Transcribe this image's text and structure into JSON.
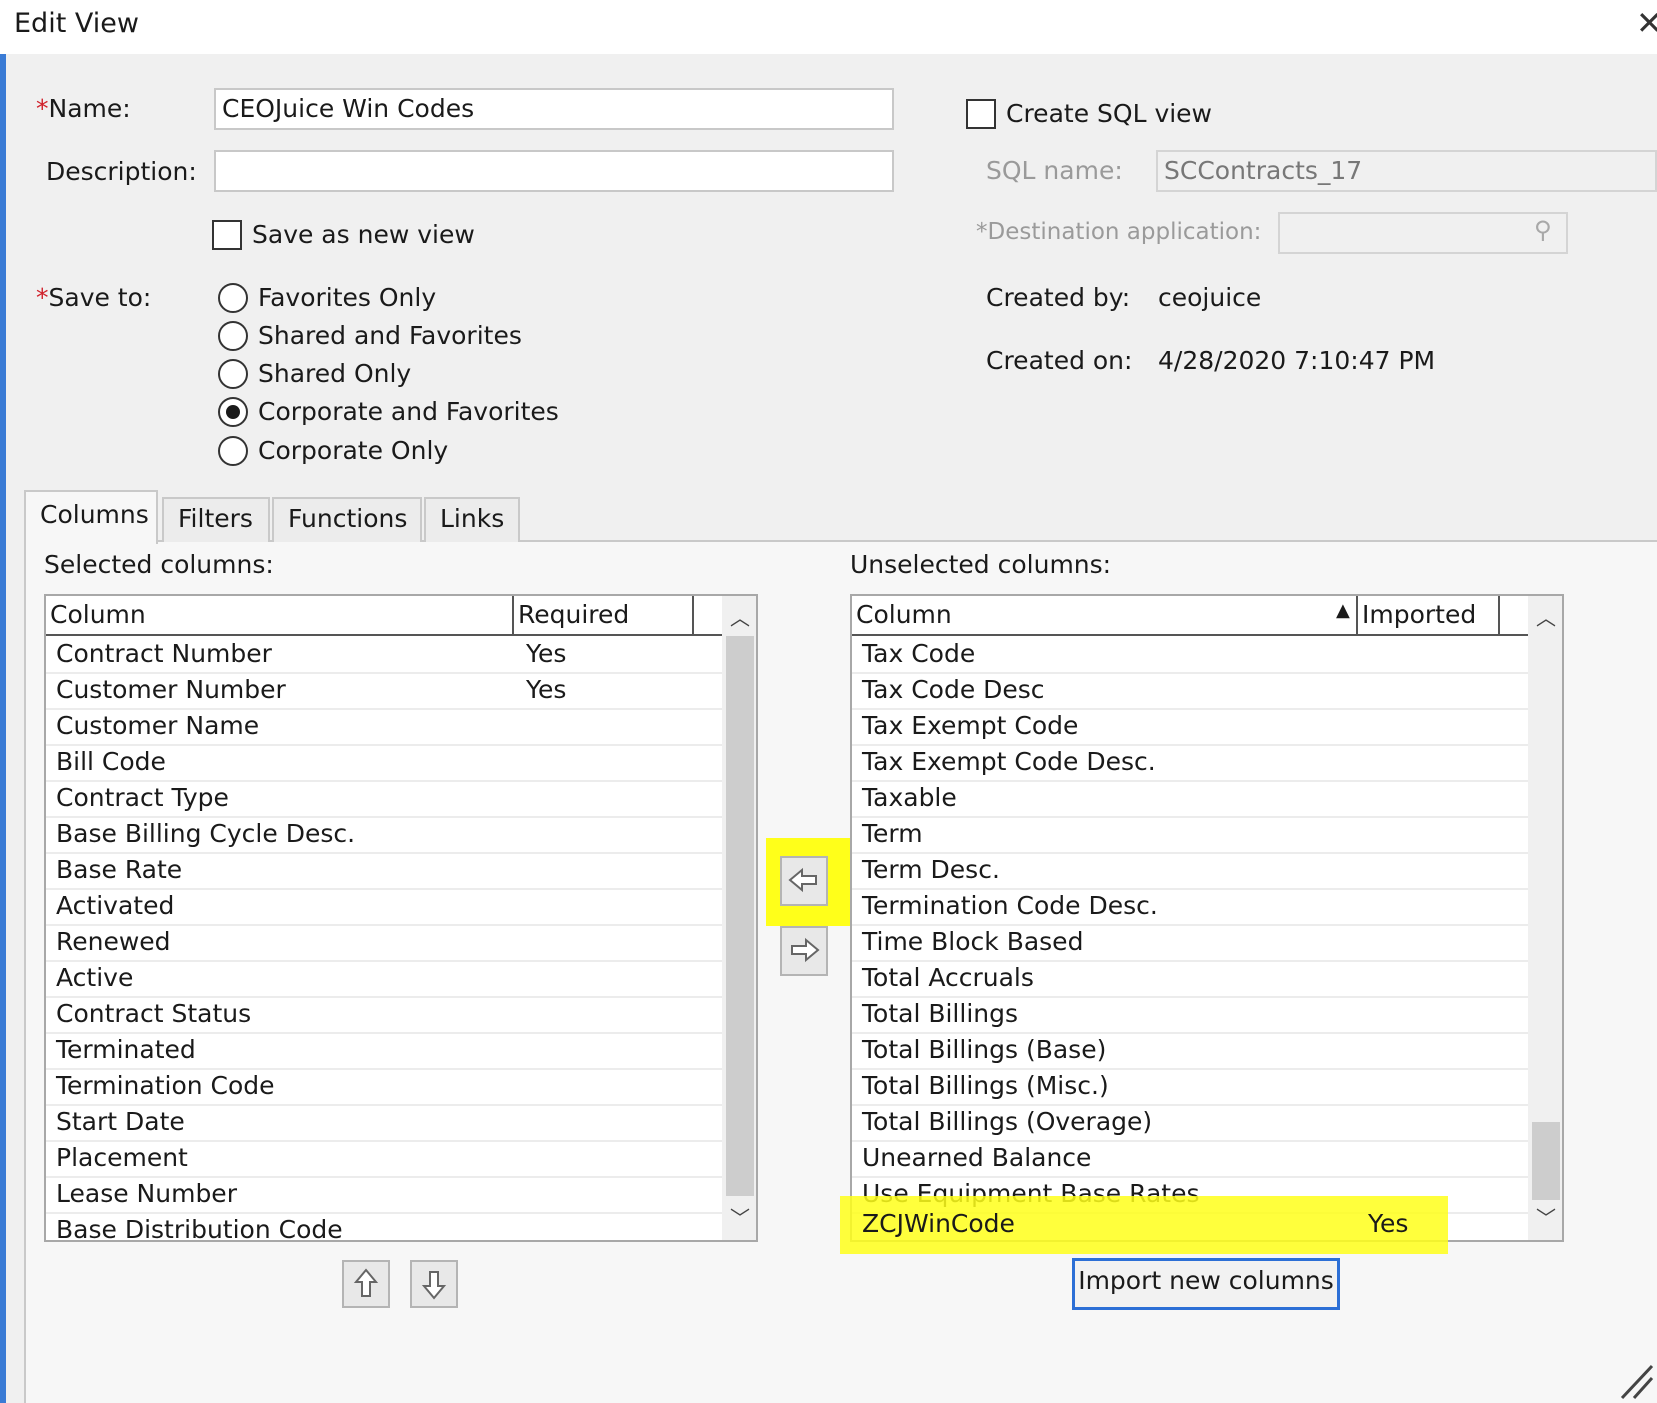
{
  "window": {
    "title": "Edit View"
  },
  "form": {
    "name_label": "Name:",
    "name_value": "CEOJuice Win Codes",
    "description_label": "Description:",
    "description_value": "",
    "save_as_new_label": "Save as new view",
    "save_to_label": "Save to:",
    "save_to_options": [
      "Favorites Only",
      "Shared and Favorites",
      "Shared Only",
      "Corporate and Favorites",
      "Corporate Only"
    ],
    "save_to_selected": "Corporate and Favorites"
  },
  "sql": {
    "create_sql_label": "Create SQL view",
    "sql_name_label": "SQL name:",
    "sql_name_value": "SCContracts_17",
    "destination_label": "*Destination application:",
    "destination_value": "",
    "created_by_label": "Created by:",
    "created_by_value": "ceojuice",
    "created_on_label": "Created on:",
    "created_on_value": "4/28/2020 7:10:47 PM"
  },
  "tabs": [
    "Columns",
    "Filters",
    "Functions",
    "Links"
  ],
  "active_tab": "Columns",
  "selected": {
    "label": "Selected columns:",
    "headers": [
      "Column",
      "Required"
    ],
    "rows": [
      [
        "Contract Number",
        "Yes"
      ],
      [
        "Customer Number",
        "Yes"
      ],
      [
        "Customer Name",
        ""
      ],
      [
        "Bill Code",
        ""
      ],
      [
        "Contract Type",
        ""
      ],
      [
        "Base Billing Cycle Desc.",
        ""
      ],
      [
        "Base Rate",
        ""
      ],
      [
        "Activated",
        ""
      ],
      [
        "Renewed",
        ""
      ],
      [
        "Active",
        ""
      ],
      [
        "Contract Status",
        ""
      ],
      [
        "Terminated",
        ""
      ],
      [
        "Termination Code",
        ""
      ],
      [
        "Start Date",
        ""
      ],
      [
        "Placement",
        ""
      ],
      [
        "Lease Number",
        ""
      ],
      [
        "Base Distribution Code",
        ""
      ]
    ]
  },
  "unselected": {
    "label": "Unselected columns:",
    "headers": [
      "Column",
      "Imported"
    ],
    "rows": [
      [
        "Tax Code",
        ""
      ],
      [
        "Tax Code Desc",
        ""
      ],
      [
        "Tax Exempt Code",
        ""
      ],
      [
        "Tax Exempt Code Desc.",
        ""
      ],
      [
        "Taxable",
        ""
      ],
      [
        "Term",
        ""
      ],
      [
        "Term Desc.",
        ""
      ],
      [
        "Termination Code Desc.",
        ""
      ],
      [
        "Time Block Based",
        ""
      ],
      [
        "Total Accruals",
        ""
      ],
      [
        "Total Billings",
        ""
      ],
      [
        "Total Billings (Base)",
        ""
      ],
      [
        "Total Billings (Misc.)",
        ""
      ],
      [
        "Total Billings (Overage)",
        ""
      ],
      [
        "Unearned Balance",
        ""
      ],
      [
        "Use Equipment Base Rates",
        ""
      ],
      [
        "ZCJWinCode",
        "Yes"
      ]
    ],
    "highlighted_row": "ZCJWinCode"
  },
  "buttons": {
    "import_new_columns": "Import new columns"
  },
  "icons": {
    "move_left": "arrow-left-icon",
    "move_right": "arrow-right-icon",
    "move_up": "arrow-up-icon",
    "move_down": "arrow-down-icon",
    "lookup": "magnifier-icon",
    "close": "close-icon",
    "sort": "sort-ascending-icon"
  },
  "colors": {
    "highlight": "#ffff1a",
    "required_marker": "#d0202a",
    "focus_border": "#2c6fd6"
  }
}
